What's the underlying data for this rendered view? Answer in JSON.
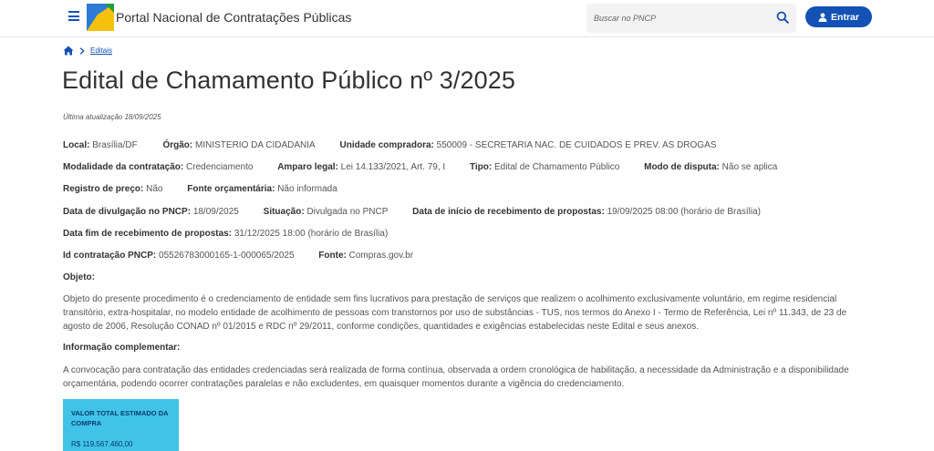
{
  "header": {
    "portal_title": "Portal Nacional de Contratações Públicas",
    "search_placeholder": "Buscar no PNCP",
    "login_label": "Entrar"
  },
  "breadcrumb": {
    "link": "Editais"
  },
  "page": {
    "title": "Edital de Chamamento Público nº 3/2025",
    "last_update": "Última atualização 18/09/2025"
  },
  "details": {
    "local_label": "Local:",
    "local_value": "Brasília/DF",
    "orgao_label": "Órgão:",
    "orgao_value": "MINISTERIO DA CIDADANIA",
    "unidade_label": "Unidade compradora:",
    "unidade_value": "550009 - SECRETARIA NAC. DE CUIDADOS E PREV. AS DROGAS",
    "modalidade_label": "Modalidade da contratação:",
    "modalidade_value": "Credenciamento",
    "amparo_label": "Amparo legal:",
    "amparo_value": "Lei 14.133/2021, Art. 79, I",
    "tipo_label": "Tipo:",
    "tipo_value": "Edital de Chamamento Público",
    "modo_label": "Modo de disputa:",
    "modo_value": "Não se aplica",
    "registro_label": "Registro de preço:",
    "registro_value": "Não",
    "fonte_orc_label": "Fonte orçamentária:",
    "fonte_orc_value": "Não informada",
    "divulgacao_label": "Data de divulgação no PNCP:",
    "divulgacao_value": "18/09/2025",
    "situacao_label": "Situação:",
    "situacao_value": "Divulgada no PNCP",
    "inicio_label": "Data de início de recebimento de propostas:",
    "inicio_value": "19/09/2025 08:00 (horário de Brasília)",
    "fim_label": "Data fim de recebimento de propostas:",
    "fim_value": "31/12/2025 18:00 (horário de Brasília)",
    "id_label": "Id contratação PNCP:",
    "id_value": "05526783000165-1-000065/2025",
    "fonte_label": "Fonte:",
    "fonte_value": "Compras.gov.br"
  },
  "objeto": {
    "label": "Objeto:",
    "text": "Objeto do presente procedimento é o credenciamento de entidade sem fins lucrativos para prestação de serviços que realizem o acolhimento exclusivamente voluntário, em regime residencial transitório, extra-hospitalar, no modelo entidade de acolhimento de pessoas com transtornos por uso de substâncias - TUS, nos termos do Anexo I - Termo de Referência, Lei nº 11.343, de 23 de agosto de 2006, Resolução CONAD nº 01/2015 e RDC nº 29/2011, conforme condições, quantidades e exigências estabelecidas neste Edital e seus anexos."
  },
  "info": {
    "label": "Informação complementar:",
    "text": "A convocação para contratação das entidades credenciadas será realizada de forma contínua, observada a ordem cronológica de habilitação, a necessidade da Administração e a disponibilidade orçamentária, podendo ocorrer contratações paralelas e não excludentes, em quaisquer momentos durante a vigência do credenciamento."
  },
  "value_card": {
    "label": "VALOR TOTAL ESTIMADO DA COMPRA",
    "amount": "R$ 119.567.460,00"
  },
  "colors": {
    "primary": "#1351b4",
    "card": "#3fc3e8"
  }
}
